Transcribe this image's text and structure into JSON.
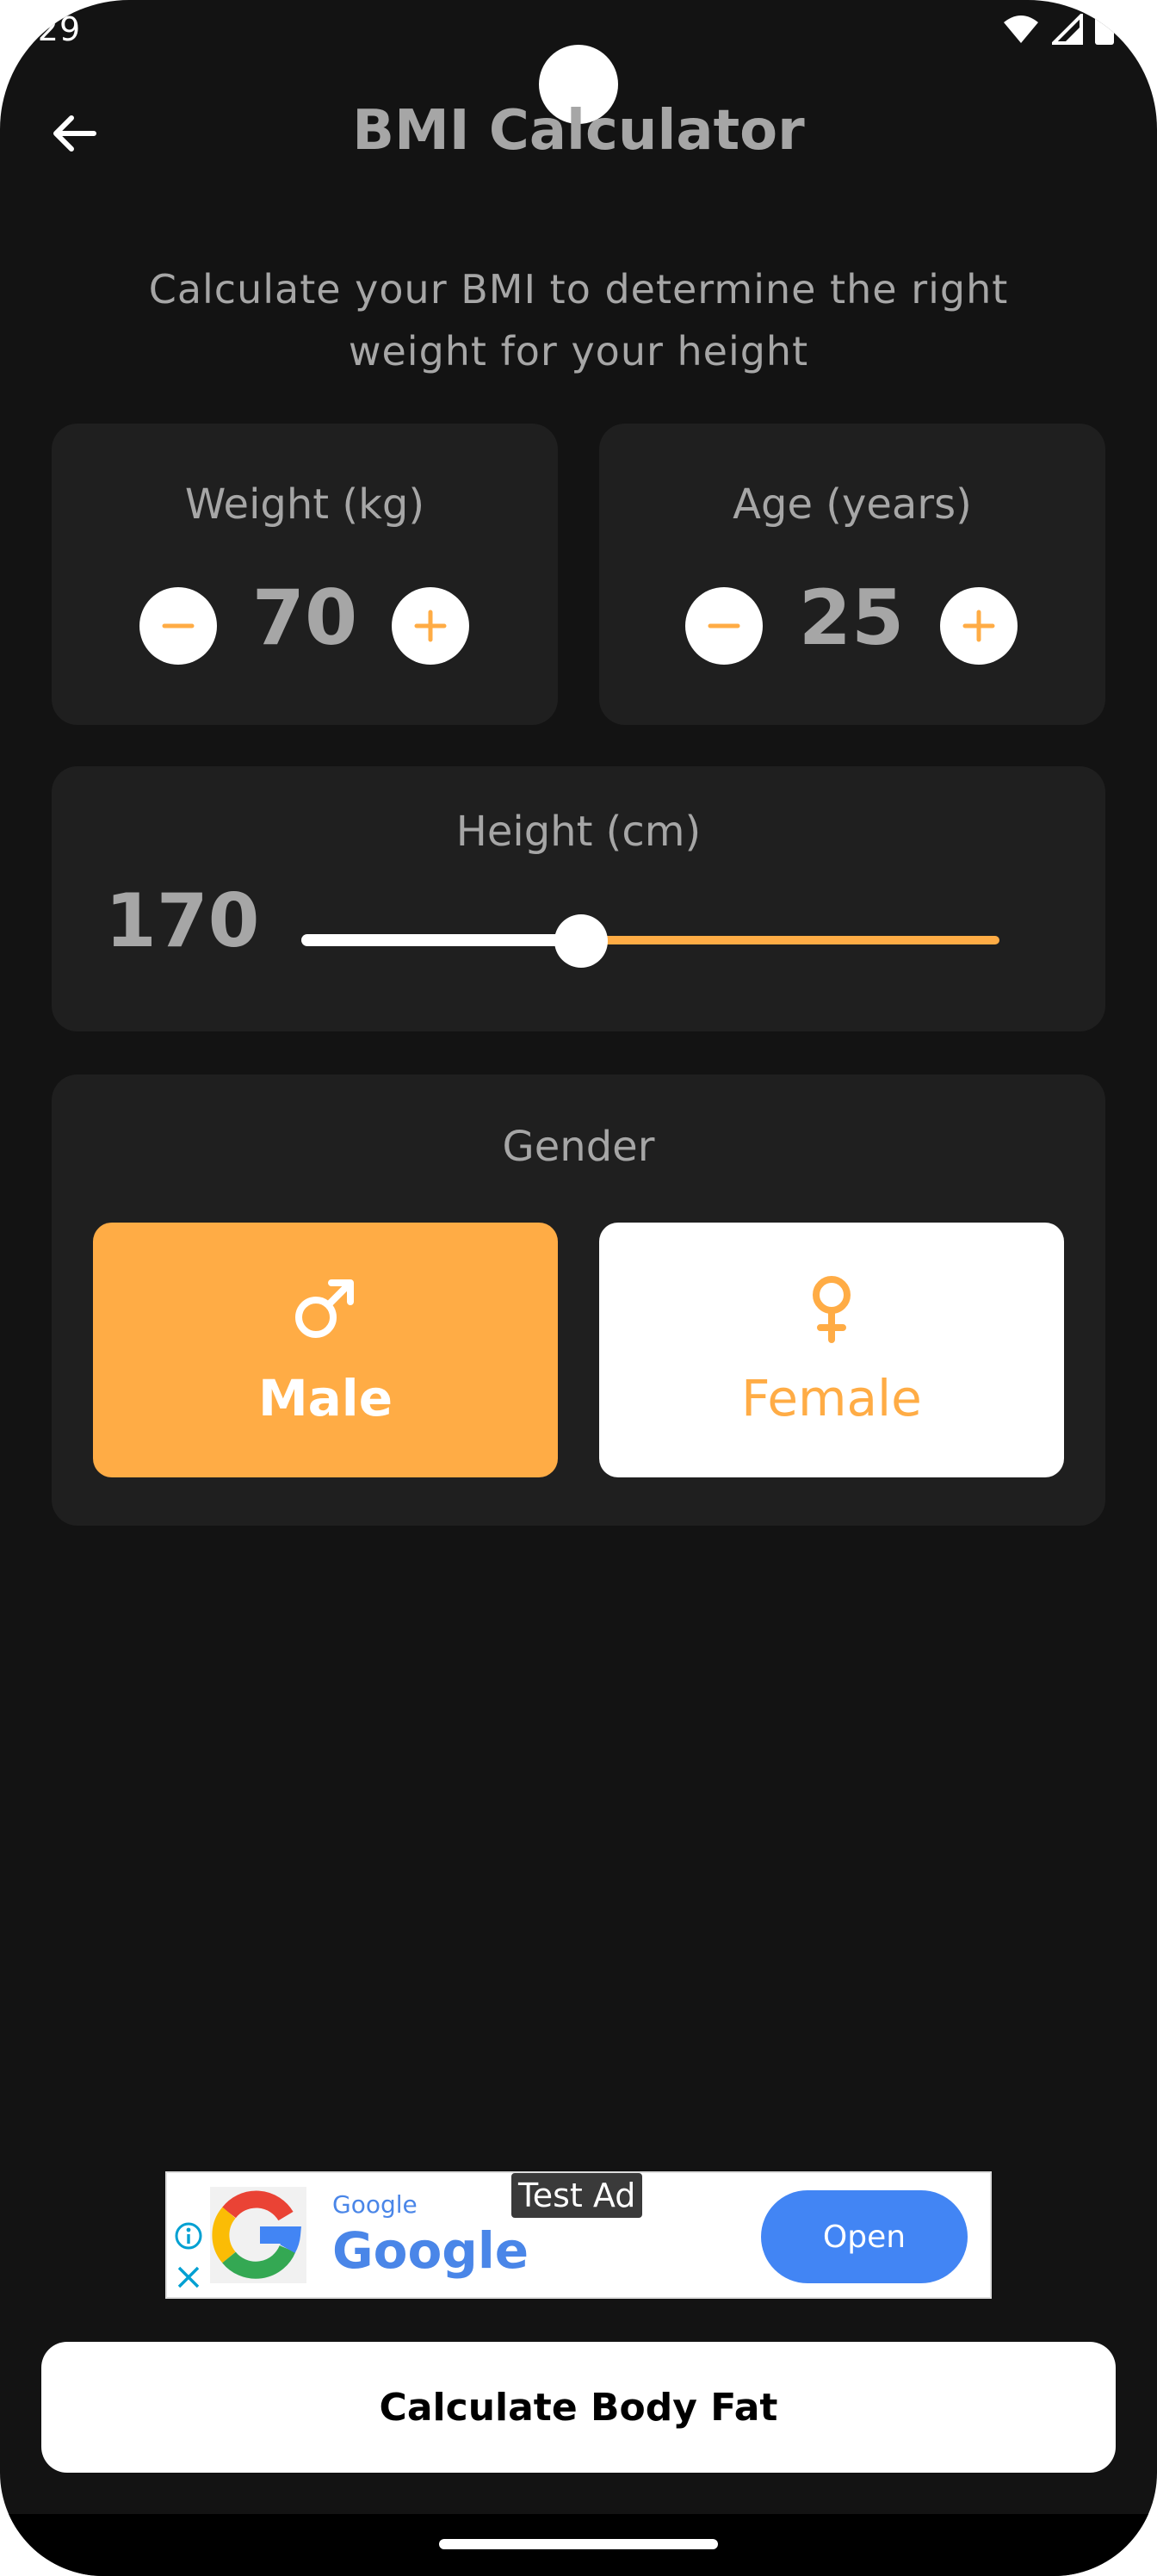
{
  "status_bar": {
    "time": ":29",
    "icons": [
      "wifi-icon",
      "signal-icon",
      "battery-icon"
    ]
  },
  "header": {
    "title": "BMI Calculator",
    "back_icon": "arrow-left-icon"
  },
  "subtitle": "Calculate your BMI to determine the right weight for your height",
  "weight": {
    "label": "Weight (kg)",
    "value": "70",
    "decrement_icon": "minus-icon",
    "increment_icon": "plus-icon"
  },
  "age": {
    "label": "Age (years)",
    "value": "25",
    "decrement_icon": "minus-icon",
    "increment_icon": "plus-icon"
  },
  "height": {
    "label": "Height (cm)",
    "value": "170",
    "slider_fraction": 0.4
  },
  "gender": {
    "label": "Gender",
    "options": [
      {
        "label": "Male",
        "icon": "male-symbol-icon",
        "selected": true
      },
      {
        "label": "Female",
        "icon": "female-symbol-icon",
        "selected": false
      }
    ]
  },
  "ad": {
    "badge": "Test Ad",
    "advertiser_small": "Google",
    "advertiser_big": "Google",
    "button": "Open",
    "icons": [
      "google-g-logo-icon",
      "info-icon",
      "close-icon"
    ]
  },
  "action": {
    "button_label": "Calculate Body Fat"
  },
  "colors": {
    "background": "#131313",
    "card": "#1f1f1f",
    "accent": "#ffac45",
    "muted_text": "#a6a6a6",
    "ad_blue": "#4285f4"
  }
}
